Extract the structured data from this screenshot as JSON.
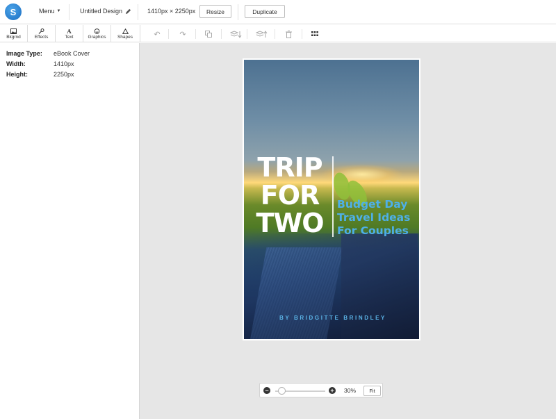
{
  "header": {
    "logo_letter": "S",
    "menu_label": "Menu",
    "design_title": "Untitled Design",
    "dimensions": "1410px × 2250px",
    "resize_label": "Resize",
    "duplicate_label": "Duplicate"
  },
  "tool_tabs": [
    {
      "label": "Bkgrnd",
      "icon": "image-icon"
    },
    {
      "label": "Effects",
      "icon": "wand-icon"
    },
    {
      "label": "Text",
      "icon": "text-icon"
    },
    {
      "label": "Graphics",
      "icon": "smiley-icon"
    },
    {
      "label": "Shapes",
      "icon": "triangle-icon"
    }
  ],
  "toolbar_icons": [
    "undo-icon",
    "redo-icon",
    "copy-icon",
    "send-backward-icon",
    "bring-forward-icon",
    "trash-icon",
    "grid-icon"
  ],
  "properties": {
    "type_label": "Image Type:",
    "type_value": "eBook Cover",
    "width_label": "Width:",
    "width_value": "1410px",
    "height_label": "Height:",
    "height_value": "2250px"
  },
  "cover": {
    "title_line1": "TRIP",
    "title_line2": "FOR",
    "title_line3": "TWO",
    "subtitle_line1": "Budget Day",
    "subtitle_line2": "Travel Ideas",
    "subtitle_line3": "For Couples",
    "byline": "BY BRIDGITTE BRINDLEY",
    "accent_color": "#4eb0e8"
  },
  "zoom": {
    "minus": "−",
    "plus": "+",
    "level_fraction": 0.3,
    "value_label": "30%",
    "fit_label": "Fit"
  }
}
